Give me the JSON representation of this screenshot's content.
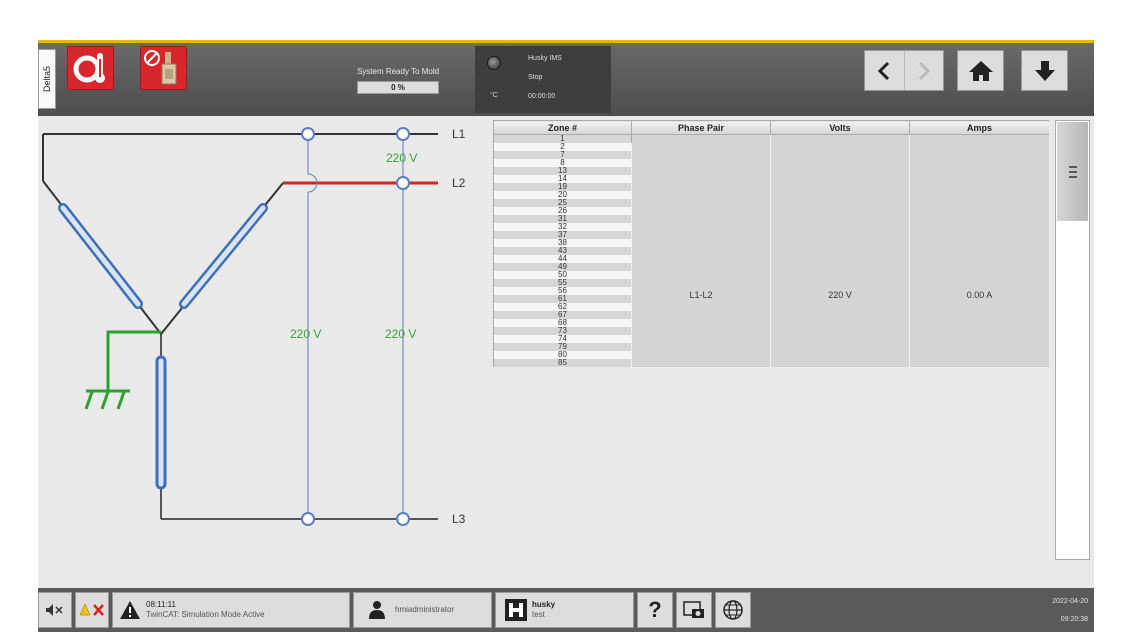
{
  "topbar": {
    "side_tab": "Delta5",
    "status_label": "System Ready To Mold",
    "status_progress": "0 %",
    "status_progress_value": 0,
    "ims": {
      "title": "Husky IMS",
      "state": "Stop",
      "time": "00:00:00",
      "unit": "°C"
    },
    "buttons": {
      "back": "back-arrow-icon",
      "forward": "forward-arrow-icon",
      "home": "home-icon",
      "download": "down-arrow-icon"
    }
  },
  "diagram": {
    "lines": [
      "L1",
      "L2",
      "L3"
    ],
    "voltage_l1_l2": "220 V",
    "voltage_l1_l3": "220 V",
    "voltage_l2_l3": "220 V",
    "colors": {
      "l1": "#333333",
      "l2": "#d92323",
      "neutral": "#2fa12f",
      "coil": "#3f6fb5"
    }
  },
  "table": {
    "headers": [
      "Zone #",
      "Phase Pair",
      "Volts",
      "Amps"
    ],
    "zones": [
      "1",
      "2",
      "7",
      "8",
      "13",
      "14",
      "19",
      "20",
      "25",
      "26",
      "31",
      "32",
      "37",
      "38",
      "43",
      "44",
      "49",
      "50",
      "55",
      "56",
      "61",
      "62",
      "67",
      "68",
      "73",
      "74",
      "79",
      "80",
      "85"
    ],
    "phase_pair": "L1-L2",
    "volts": "220 V",
    "amps": "0.00 A"
  },
  "bottombar": {
    "mute_icon": "speaker-mute-icon",
    "alarm_time": "08:11:11",
    "alarm_message": "TwinCAT: Simulation Mode Active",
    "user": "hmiadministrator",
    "brand": "husky",
    "brand_sub": "test",
    "help": "?",
    "date": "2022-04-20",
    "time": "09:20:38"
  }
}
